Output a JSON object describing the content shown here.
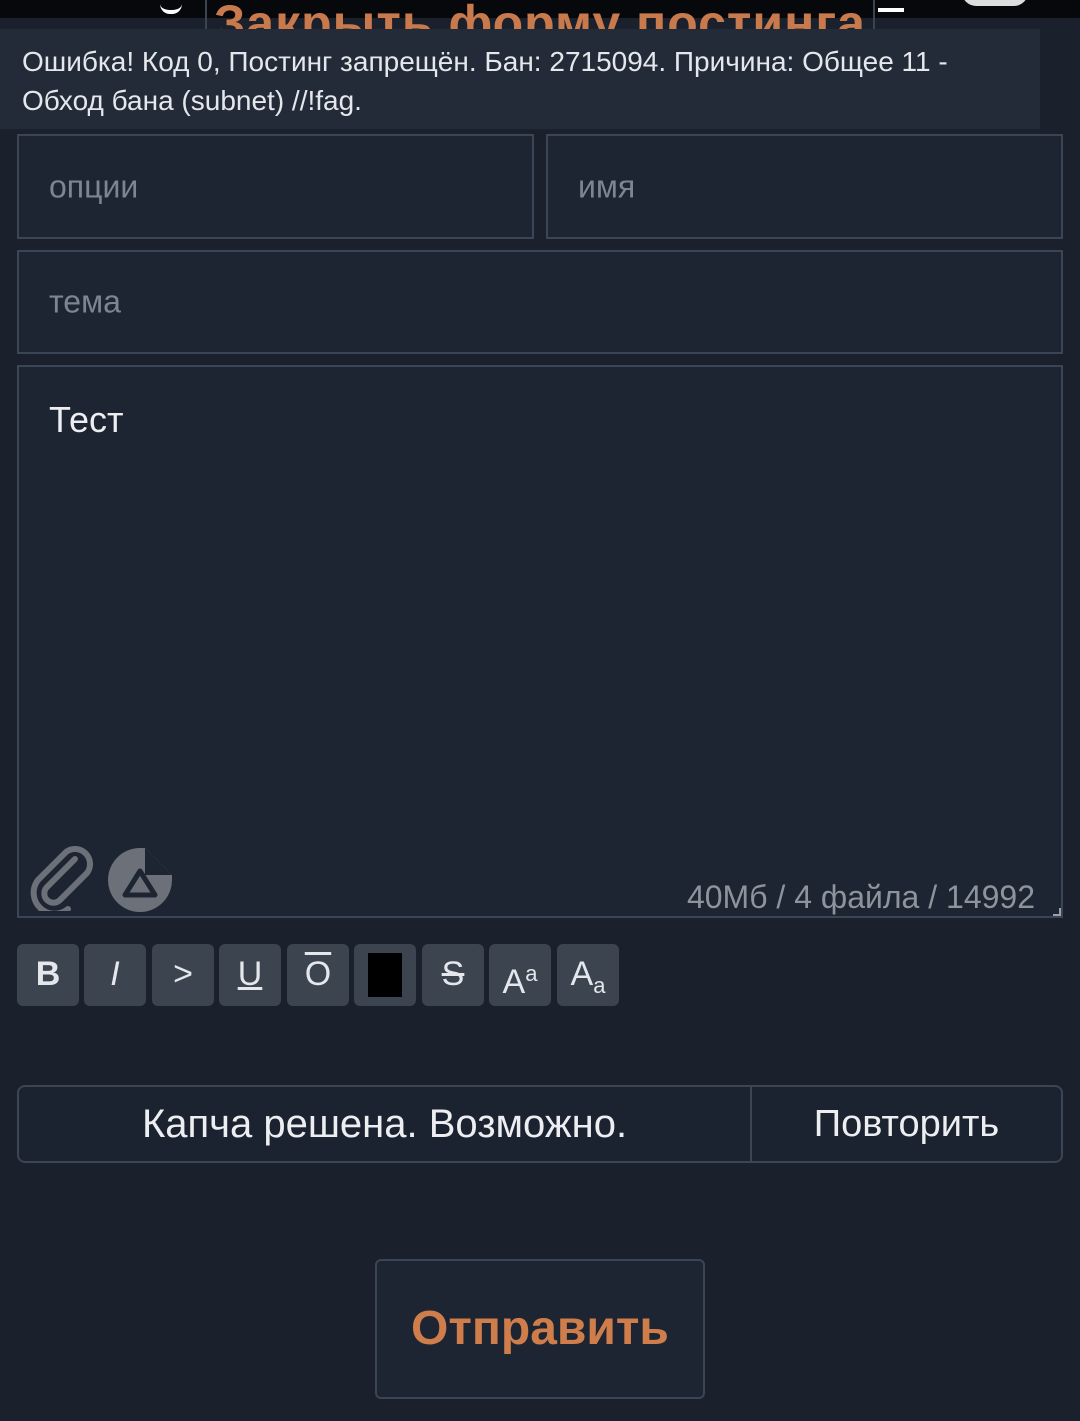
{
  "header": {
    "close_form_label": "Закрыть форму постинга"
  },
  "error_banner": {
    "line1": "Ошибка! Код 0, Постинг запрещён. Бан: 2715094. Причина: Общее 11 -",
    "line2": "Обход бана (subnet) //!fag."
  },
  "form": {
    "options_placeholder": "опции",
    "name_placeholder": "имя",
    "subject_placeholder": "тема",
    "comment_value": "Тест",
    "limits": "40Мб / 4 файла / 14992",
    "attach_icon": "paperclip-icon",
    "sticker_icon": "sticker-icon"
  },
  "toolbar": {
    "buttons": [
      {
        "label": "B",
        "name": "bold-button"
      },
      {
        "label": "I",
        "name": "italic-button"
      },
      {
        "label": ">",
        "name": "quote-button"
      },
      {
        "label": "U",
        "name": "underline-button"
      },
      {
        "label": "O",
        "name": "overline-button"
      },
      {
        "label": "",
        "name": "color-button"
      },
      {
        "label": "S",
        "name": "strike-button"
      },
      {
        "label": "A",
        "sup": "a",
        "name": "superscript-button"
      },
      {
        "label": "A",
        "sub": "a",
        "name": "subscript-button"
      }
    ]
  },
  "captcha": {
    "status": "Капча решена. Возможно.",
    "retry_label": "Повторить"
  },
  "submit_label": "Отправить",
  "colors": {
    "background": "#1a212d",
    "field_background": "#1e2532",
    "border": "#3b4553",
    "accent": "#cf7d4b",
    "toolbar_button": "#3c4450"
  }
}
